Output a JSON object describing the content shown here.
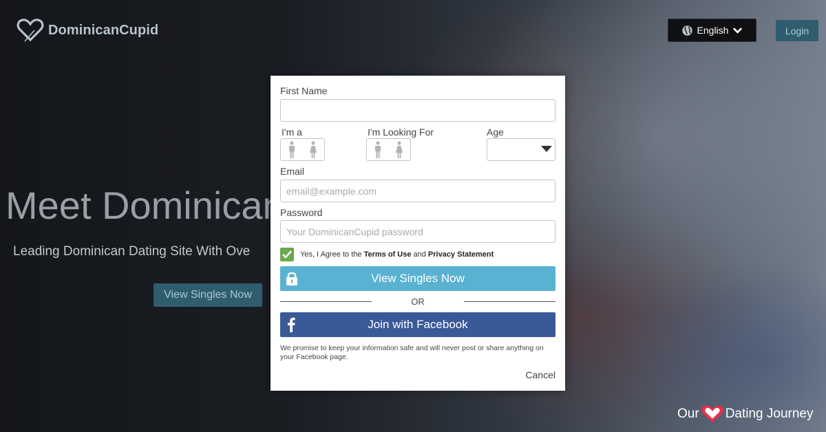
{
  "header": {
    "logo_text": "DominicanCupid",
    "language_label": "English",
    "login_label": "Login"
  },
  "hero": {
    "title": "Meet Dominican",
    "subtitle": "Leading Dominican Dating Site With Ove",
    "cta_label": "View Singles Now"
  },
  "form": {
    "first_name_label": "First Name",
    "first_name_value": "",
    "im_a_label": "I'm a",
    "looking_for_label": "I'm Looking For",
    "age_label": "Age",
    "age_value": "",
    "email_label": "Email",
    "email_placeholder": "email@example.com",
    "password_label": "Password",
    "password_placeholder": "Your DominicanCupid password",
    "agree_checked": true,
    "agree_prefix": "Yes, I Agree to the ",
    "terms_label": "Terms of Use",
    "agree_and": " and ",
    "privacy_label": "Privacy Statement",
    "submit_label": "View Singles Now",
    "or_label": "OR",
    "facebook_label": "Join with Facebook",
    "promise_text": "We promise to keep your information safe and will never post or share anything on your Facebook page.",
    "cancel_label": "Cancel"
  },
  "watermark": {
    "prefix": "Our",
    "suffix": "Dating Journey"
  },
  "colors": {
    "primary_button": "#59b2d1",
    "facebook": "#3a5998",
    "checkbox": "#6aa94c",
    "header_button": "#2e5d6e",
    "watermark_heart": "#e8304a"
  }
}
